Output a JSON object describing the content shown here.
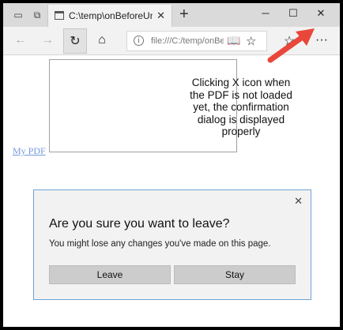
{
  "browser": {
    "tab": {
      "title": "C:\\temp\\onBeforeUnloa",
      "close_glyph": "✕"
    },
    "new_tab_glyph": "+",
    "window_controls": {
      "minimize": "─",
      "maximize": "☐",
      "close": "✕"
    },
    "nav": {
      "back": "←",
      "forward": "→",
      "refresh": "↻",
      "home": "⌂"
    },
    "address": {
      "info_glyph": "i",
      "url": "file:///C:/temp/onBe",
      "reading_glyph": "📖",
      "favorite_glyph": "☆"
    },
    "toolbar_right": {
      "favorites_glyph": "☆",
      "more_glyph": "···"
    }
  },
  "page": {
    "link_text": "My PDF",
    "annotation": "Clicking X icon when the PDF is not loaded yet, the confirmation dialog is displayed properly"
  },
  "dialog": {
    "close_glyph": "✕",
    "title": "Are you sure you want to leave?",
    "message": "You might lose any changes you've made on this page.",
    "leave_label": "Leave",
    "stay_label": "Stay"
  },
  "colors": {
    "arrow": "#e8473a",
    "dialog_border": "#6fa4d8",
    "link": "#7799dd"
  }
}
